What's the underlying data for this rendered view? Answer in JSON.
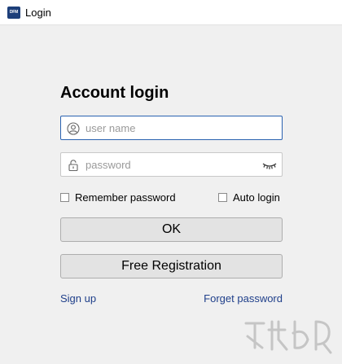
{
  "window": {
    "title": "Login",
    "app_icon_text": "DFM"
  },
  "form": {
    "heading": "Account login",
    "username": {
      "placeholder": "user name",
      "value": ""
    },
    "password": {
      "placeholder": "password",
      "value": ""
    },
    "remember_label": "Remember password",
    "auto_login_label": "Auto login",
    "ok_label": "OK",
    "register_label": "Free Registration",
    "sign_up_label": "Sign up",
    "forget_label": "Forget password"
  },
  "icons": {
    "user": "user-icon",
    "lock": "lock-icon",
    "eye": "eye-closed-icon"
  },
  "colors": {
    "focus_border": "#2a62b0",
    "link": "#1f3f8a",
    "button_bg": "#e3e3e3",
    "window_bg": "#f0f0f0"
  }
}
